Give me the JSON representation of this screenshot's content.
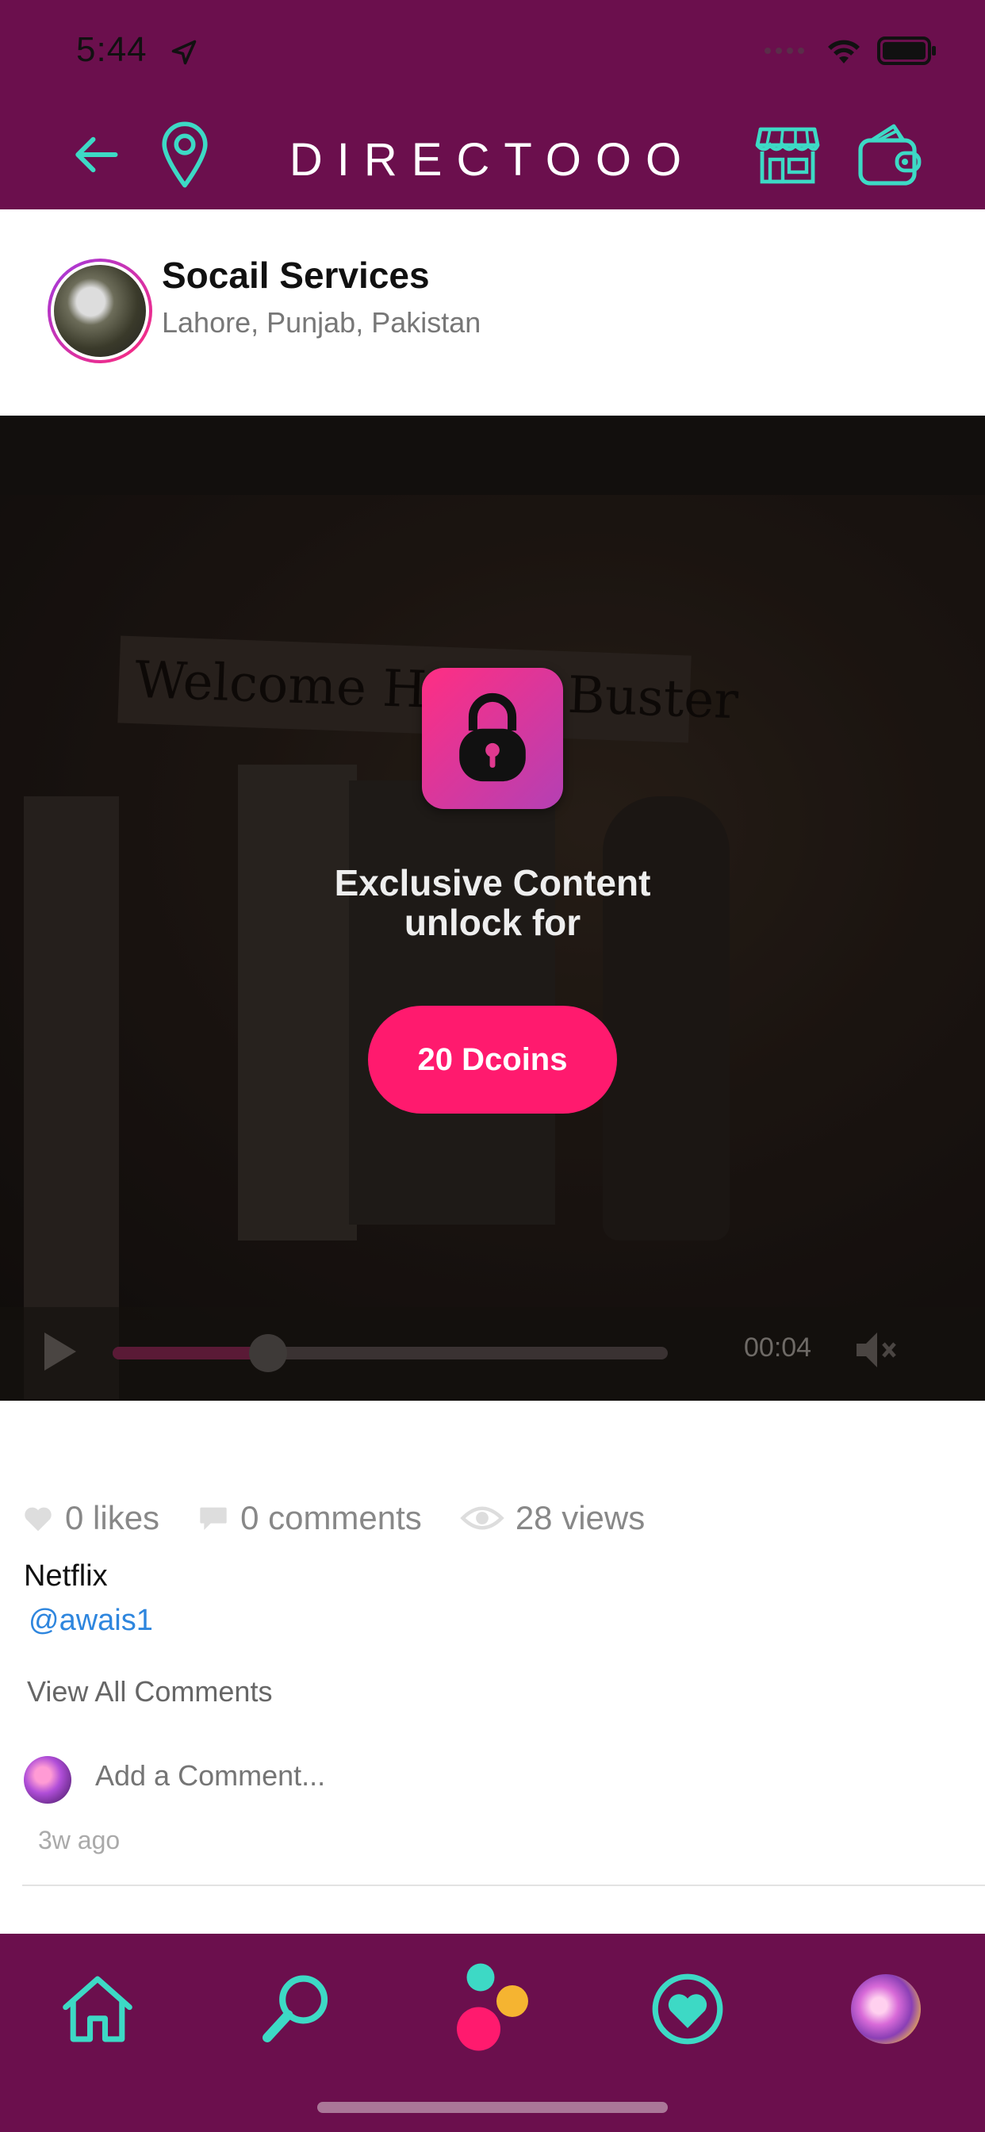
{
  "status": {
    "time": "5:44"
  },
  "header": {
    "title": "DIRECTOOO"
  },
  "profile": {
    "name": "Socail Services",
    "location": "Lahore, Punjab, Pakistan"
  },
  "media": {
    "banner_text": "Welcome Home, Buster",
    "unlock_line1": "Exclusive Content",
    "unlock_line2": "unlock for",
    "unlock_button": "20 Dcoins",
    "time": "00:04",
    "progress": 0.28
  },
  "stats": {
    "likes": "0 likes",
    "comments": "0 comments",
    "views": "28 views"
  },
  "post": {
    "caption": "Netflix",
    "mention": "@awais1",
    "view_all": "View All Comments",
    "comment_placeholder": "Add a Comment...",
    "time_ago": "3w ago"
  },
  "colors": {
    "brand": "#6b0f4d",
    "accent": "#3dd9c5",
    "pink": "#ff1a6e"
  }
}
